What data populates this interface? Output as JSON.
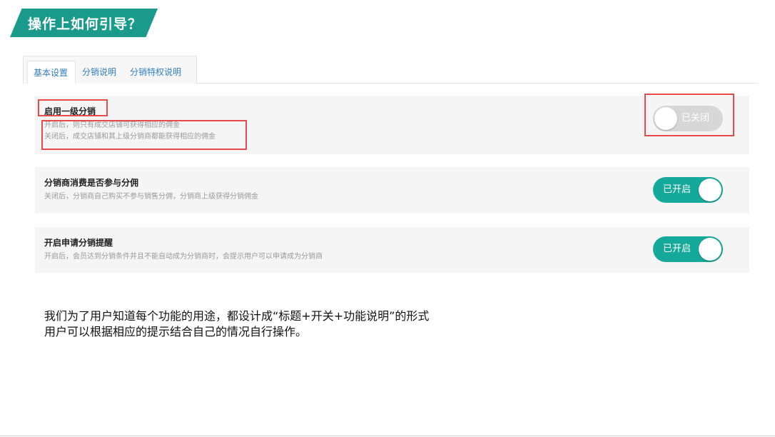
{
  "slide": {
    "heading": "操作上如何引导？",
    "caption_line1": "我们为了用户知道每个功能的用途，都设计成“标题+开关+功能说明”的形式",
    "caption_line2": "用户可以根据相应的提示结合自己的情况自行操作。"
  },
  "tabs": [
    {
      "label": "基本设置",
      "active": true
    },
    {
      "label": "分销说明",
      "active": false
    },
    {
      "label": "分销特权说明",
      "active": false
    }
  ],
  "settings": [
    {
      "title": "启用一级分销",
      "desc_lines": [
        "开启后，则只有成交店铺可获得相应的佣金",
        "关闭后，成交店铺和其上级分销商都能获得相应的佣金"
      ],
      "toggle_label": "已关闭",
      "toggle_on": false
    },
    {
      "title": "分销商消费是否参与分佣",
      "desc_lines": [
        "关闭后，分销商自己购买不参与销售分佣，分销商上级获得分销佣金"
      ],
      "toggle_label": "已开启",
      "toggle_on": true
    },
    {
      "title": "开启申请分销提醒",
      "desc_lines": [
        "开启后，会员达到分销条件并且不能自动成为分销商时，会提示用户可以申请成为分销商"
      ],
      "toggle_label": "已开启",
      "toggle_on": true
    }
  ],
  "colors": {
    "accent": "#14a99a",
    "banner": "#1a9a8a",
    "annotation": "#e54b4b",
    "tab_text": "#2f7fbf"
  }
}
